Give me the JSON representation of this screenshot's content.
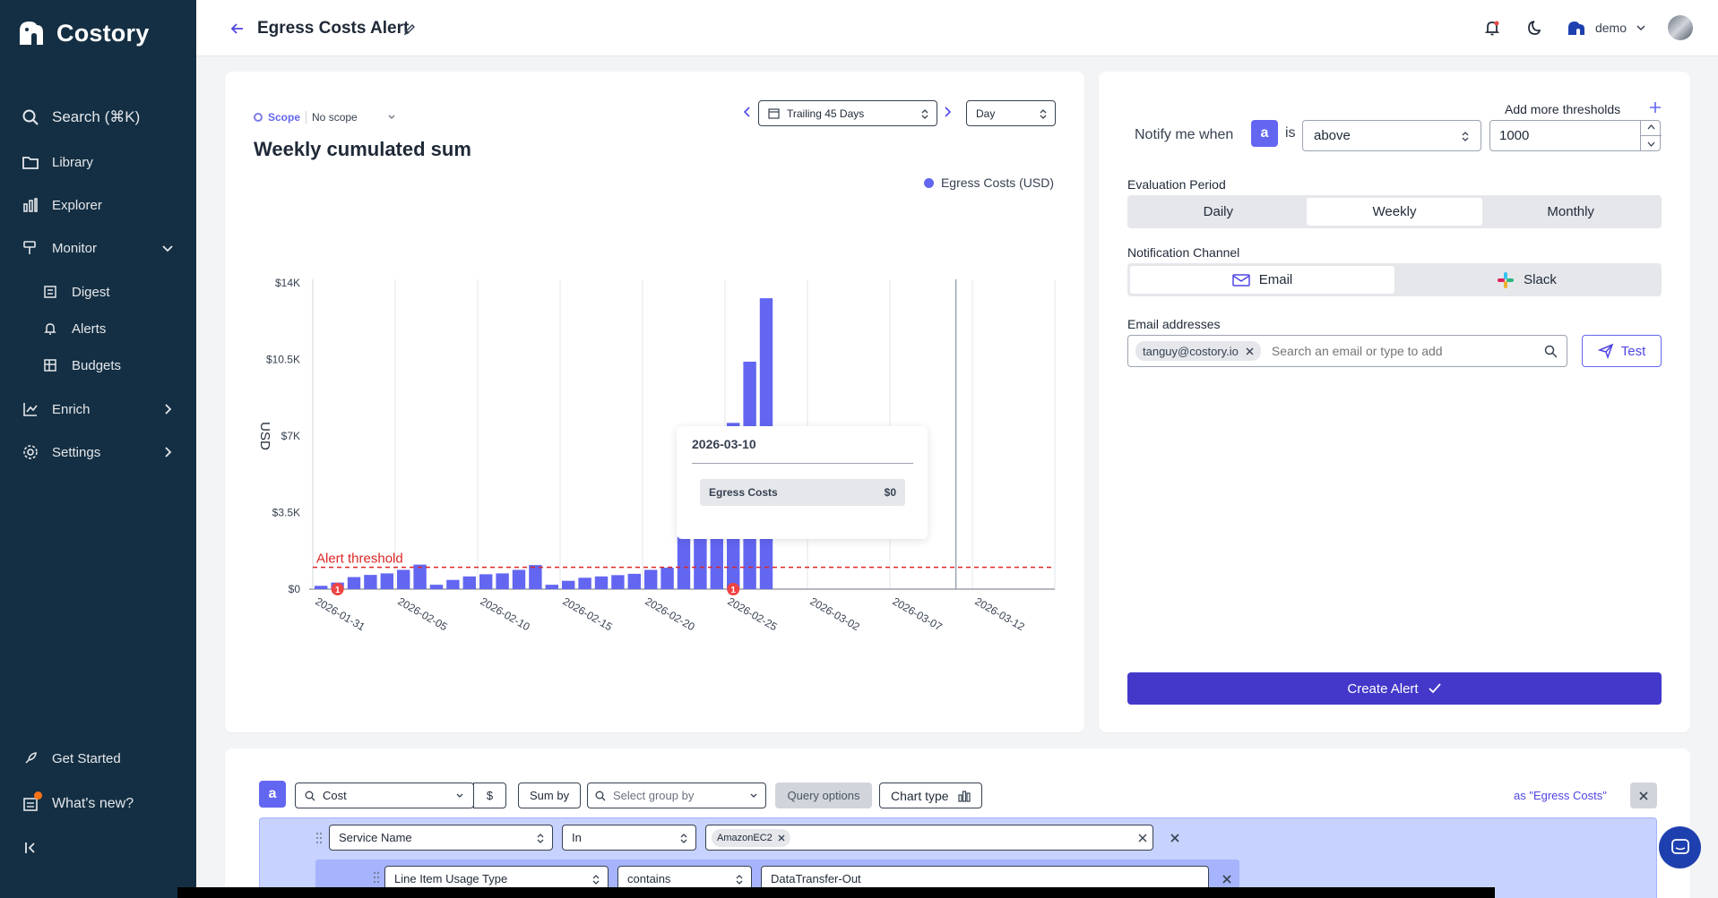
{
  "app": {
    "name": "Costory"
  },
  "sidebar": {
    "search_label": "Search (⌘K)",
    "items": [
      {
        "label": "Library",
        "icon": "folder-icon"
      },
      {
        "label": "Explorer",
        "icon": "bar-chart-icon"
      },
      {
        "label": "Monitor",
        "icon": "monitor-icon"
      },
      {
        "label": "Digest",
        "icon": "digest-icon"
      },
      {
        "label": "Alerts",
        "icon": "bell-icon"
      },
      {
        "label": "Budgets",
        "icon": "budget-icon"
      },
      {
        "label": "Enrich",
        "icon": "enrich-icon"
      },
      {
        "label": "Settings",
        "icon": "gear-icon"
      }
    ],
    "footer": {
      "get_started": "Get Started",
      "whats_new": "What's new?"
    }
  },
  "header": {
    "title": "Egress Costs Alert",
    "user": "demo"
  },
  "chart_panel": {
    "scope_label": "Scope",
    "scope_value": "No scope",
    "range_label": "Trailing 45 Days",
    "granularity": "Day",
    "title": "Weekly cumulated sum",
    "legend": "Egress Costs (USD)",
    "threshold_label": "Alert threshold",
    "ylabel": "USD",
    "tooltip": {
      "date": "2026-03-10",
      "series": "Egress Costs",
      "value": "$0"
    }
  },
  "chart_data": {
    "type": "bar",
    "title": "Weekly cumulated sum",
    "ylabel": "USD",
    "ylim": [
      0,
      14000
    ],
    "yticks": [
      "$0",
      "$3.5K",
      "$7K",
      "$10.5K",
      "$14K"
    ],
    "xticks": [
      "2026-01-31",
      "2026-02-05",
      "2026-02-10",
      "2026-02-15",
      "2026-02-20",
      "2026-02-25",
      "2026-03-02",
      "2026-03-07",
      "2026-03-12"
    ],
    "series": [
      {
        "name": "Egress Costs (USD)",
        "values": [
          150,
          300,
          550,
          650,
          720,
          880,
          1120,
          200,
          420,
          580,
          680,
          720,
          880,
          1100,
          200,
          380,
          520,
          580,
          640,
          700,
          880,
          980,
          6800,
          7000,
          7200,
          7600,
          10400,
          13300,
          0,
          0,
          0,
          0,
          0,
          0,
          0,
          0,
          0,
          0,
          0,
          0,
          0,
          0,
          0,
          0,
          0
        ]
      }
    ],
    "threshold": 1000,
    "markers": [
      {
        "index": 1,
        "label": "1"
      },
      {
        "index": 25,
        "label": "1"
      }
    ],
    "grid": true,
    "legend_position": "top-right"
  },
  "form": {
    "notify_label": "Notify me when",
    "series_chip": "a",
    "is_label": "is",
    "comparator": "above",
    "threshold_value": "1000",
    "add_thresholds": "Add more thresholds",
    "evaluation_label": "Evaluation Period",
    "periods": [
      "Daily",
      "Weekly",
      "Monthly"
    ],
    "active_period": "Weekly",
    "channel_label": "Notification Channel",
    "channels": [
      "Email",
      "Slack"
    ],
    "emails_label": "Email addresses",
    "email_chip": "tanguy@costory.io",
    "email_placeholder": "Search an email or type to add",
    "test_label": "Test",
    "create_label": "Create Alert"
  },
  "query": {
    "chip": "a",
    "metric": "Cost",
    "unit": "$",
    "sum_by": "Sum by",
    "group_placeholder": "Select group by",
    "options": "Query options",
    "chart_type": "Chart type",
    "alias": "as \"Egress Costs\"",
    "filters": [
      {
        "field": "Service Name",
        "op": "In",
        "value": "AmazonEC2"
      },
      {
        "field": "Line Item Usage Type",
        "op": "contains",
        "value": "DataTransfer-Out"
      }
    ]
  },
  "colors": {
    "sidebar": "#142f43",
    "accent": "#6366f1",
    "primary_button": "#4338ca",
    "threshold": "#dc2626"
  }
}
